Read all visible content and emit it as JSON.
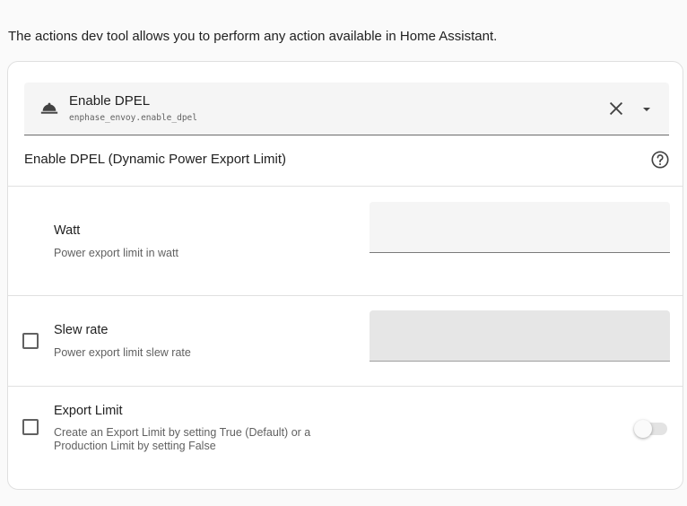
{
  "intro_text": "The actions dev tool allows you to perform any action available in Home Assistant.",
  "service_picker": {
    "name": "Enable DPEL",
    "id": "enphase_envoy.enable_dpel",
    "icon": "service-bell-icon"
  },
  "description": "Enable DPEL (Dynamic Power Export Limit)",
  "fields": [
    {
      "name": "Watt",
      "description": "Power export limit in watt",
      "value": "",
      "checked": null
    },
    {
      "name": "Slew rate",
      "description": "Power export limit slew rate",
      "value": "",
      "checked": false
    },
    {
      "name": "Export Limit",
      "description": "Create an Export Limit by setting True (Default) or a Production Limit by setting False",
      "checked": false,
      "toggle_on": false
    }
  ],
  "colors": {
    "background": "#fafafa",
    "card": "#ffffff",
    "field_bg": "#f5f5f5",
    "field_disabled_bg": "#e6e6e6",
    "text_primary": "#212121",
    "text_secondary": "#616161"
  }
}
